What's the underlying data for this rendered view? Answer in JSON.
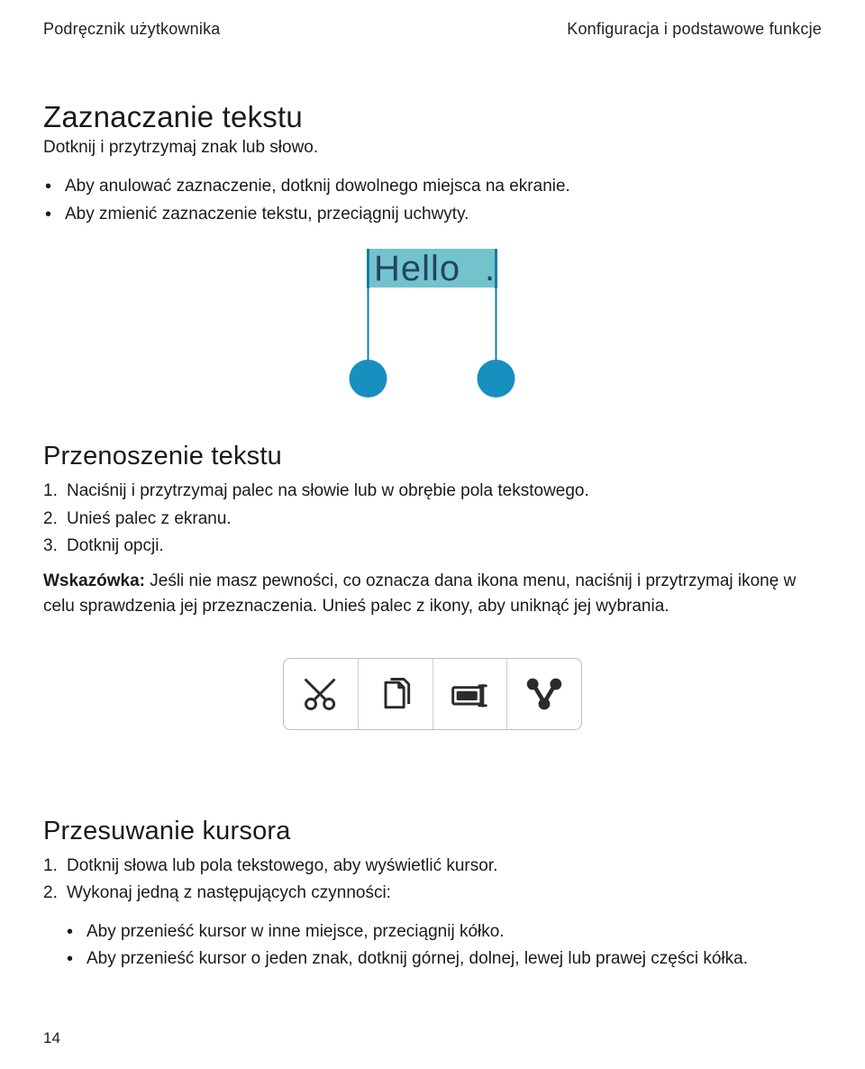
{
  "header": {
    "left": "Podręcznik użytkownika",
    "right": "Konfiguracja i podstawowe funkcje"
  },
  "section_select": {
    "title": "Zaznaczanie tekstu",
    "intro": "Dotknij i przytrzymaj znak lub słowo.",
    "bullets": [
      "Aby anulować zaznaczenie, dotknij dowolnego miejsca na ekranie.",
      "Aby zmienić zaznaczenie tekstu, przeciągnij uchwyty."
    ],
    "figure_text": "Hello."
  },
  "section_move": {
    "title": "Przenoszenie tekstu",
    "steps": [
      "Naciśnij i przytrzymaj palec na słowie lub w obrębie pola tekstowego.",
      "Unieś palec z ekranu.",
      "Dotknij opcji."
    ],
    "hint_label": "Wskazówka:",
    "hint_text": " Jeśli nie masz pewności, co oznacza dana ikona menu, naciśnij i przytrzymaj ikonę w celu sprawdzenia jej przeznaczenia. Unieś palec z ikony, aby uniknąć jej wybrania.",
    "toolbar_icons": [
      "cut-icon",
      "copy-icon",
      "paste-icon",
      "share-icon"
    ]
  },
  "section_cursor": {
    "title": "Przesuwanie kursora",
    "steps": [
      "Dotknij słowa lub pola tekstowego, aby wyświetlić kursor.",
      "Wykonaj jedną z następujących czynności:"
    ],
    "sub_bullets": [
      "Aby przenieść kursor w inne miejsce, przeciągnij kółko.",
      "Aby przenieść kursor o jeden znak, dotknij górnej, dolnej, lewej lub prawej części kółka."
    ]
  },
  "page_number": "14"
}
